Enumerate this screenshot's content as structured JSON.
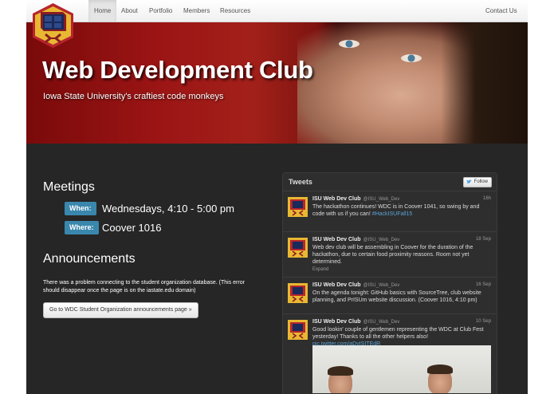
{
  "nav": {
    "items": [
      "Home",
      "About",
      "Portfolio",
      "Members",
      "Resources"
    ],
    "active": "Home",
    "contact": "Contact Us"
  },
  "hero": {
    "title": "Web Development Club",
    "subtitle": "Iowa State University's craftiest code monkeys"
  },
  "meetings": {
    "title": "Meetings",
    "when_label": "When:",
    "when_value": "Wednesdays, 4:10 - 5:00 pm",
    "where_label": "Where:",
    "where_value": "Coover 1016"
  },
  "announcements": {
    "title": "Announcements",
    "text": "There was a problem connecting to the student organization database. (This error should disappear once the page is on the iastate.edu domain)",
    "button": "Go to WDC Student Organization announcements page »"
  },
  "tweets": {
    "title": "Tweets",
    "follow": "Follow",
    "items": [
      {
        "name": "ISU Web Dev Club",
        "handle": "@ISU_Web_Dev",
        "date": "16h",
        "text": "The hackathon continues! WDC is in Coover 1041, so swing by and code with us if you can! ",
        "link": "#HackISUFall15"
      },
      {
        "name": "ISU Web Dev Club",
        "handle": "@ISU_Web_Dev",
        "date": "18 Sep",
        "text": "Web dev club will be assembling in Coover for the duration of the hackathon, due to certain food proximity reasons. Room not yet determined.",
        "expand": "Expand"
      },
      {
        "name": "ISU Web Dev Club",
        "handle": "@ISU_Web_Dev",
        "date": "16 Sep",
        "text": "On the agenda tonight: GitHub basics with SourceTree, club website planning, and PrISUm website discussion. (Coover 1016, 4:10 pm)"
      },
      {
        "name": "ISU Web Dev Club",
        "handle": "@ISU_Web_Dev",
        "date": "10 Sep",
        "text": "Good lookin' couple of gentlemen representing the WDC at Club Fest yesterday! Thanks to all the other helpers also!",
        "link": "pic.twitter.com/aDyISITEdR"
      }
    ]
  },
  "colors": {
    "label_blue": "#3a87ad",
    "page_bg": "#262626",
    "link": "#5ba4d6",
    "hero_red": "#9a1414"
  }
}
